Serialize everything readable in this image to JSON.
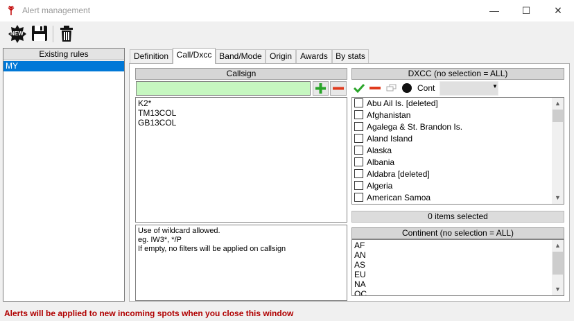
{
  "window": {
    "title": "Alert management",
    "icon": "antenna-icon",
    "minimize": "—",
    "maximize": "☐",
    "close": "✕"
  },
  "toolbar": {
    "new_label": "NEW",
    "save_icon": "save-icon",
    "delete_icon": "trash-icon"
  },
  "rules": {
    "header": "Existing rules",
    "items": [
      "MY"
    ]
  },
  "tabs": [
    {
      "label": "Definition"
    },
    {
      "label": "Call/Dxcc"
    },
    {
      "label": "Band/Mode"
    },
    {
      "label": "Origin"
    },
    {
      "label": "Awards"
    },
    {
      "label": "By stats"
    }
  ],
  "callsign": {
    "header": "Callsign",
    "input_value": "",
    "add_icon": "plus-icon",
    "remove_icon": "minus-icon",
    "items": [
      "K2*",
      "TM13COL",
      "GB13COL"
    ],
    "help_lines": [
      "Use of wildcard allowed.",
      "eg. IW3*, */P",
      "If empty, no filters will be applied on callsign"
    ]
  },
  "dxcc": {
    "header": "DXCC (no selection = ALL)",
    "cont_label": "Cont",
    "cont_value": "",
    "items": [
      "Abu Ail Is. [deleted]",
      "Afghanistan",
      "Agalega & St. Brandon Is.",
      "Aland Island",
      "Alaska",
      "Albania",
      "Aldabra [deleted]",
      "Algeria",
      "American Samoa"
    ],
    "selected_count": "0 items selected"
  },
  "continent": {
    "header": "Continent (no selection = ALL)",
    "items": [
      "AF",
      "AN",
      "AS",
      "EU",
      "NA",
      "OC"
    ]
  },
  "status": "Alerts will be applied to new incoming spots when you close this window",
  "colors": {
    "input_bg": "#c6f7c0",
    "selection": "#0078d7",
    "status_text": "#b00000"
  }
}
